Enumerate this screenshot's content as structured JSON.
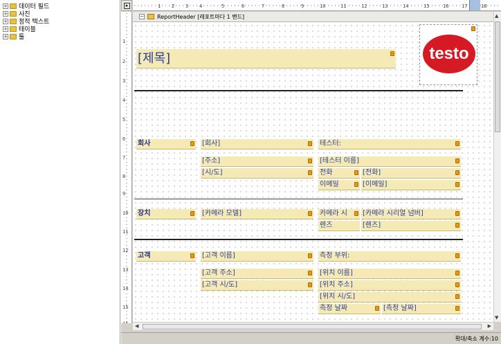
{
  "tree": {
    "items": [
      {
        "label": "데이터 필드",
        "expander": "+"
      },
      {
        "label": "사진",
        "expander": "+"
      },
      {
        "label": "정적 텍스트",
        "expander": "+"
      },
      {
        "label": "테이블",
        "expander": "+"
      },
      {
        "label": "툴",
        "expander": "+"
      }
    ]
  },
  "corner_label": "▸",
  "ruler": {
    "h_ticks": [
      "1",
      "2",
      "3",
      "4",
      "5",
      "6",
      "7",
      "8",
      "9",
      "10",
      "11",
      "12",
      "13",
      "14",
      "15",
      "16",
      "17",
      "18"
    ],
    "v_ticks": [
      "1",
      "2",
      "3",
      "4",
      "5",
      "6",
      "7",
      "8",
      "9",
      "10",
      "11",
      "12",
      "13",
      "14",
      "15",
      "16"
    ]
  },
  "band": {
    "title": "ReportHeader [레포트마다 1 밴드]",
    "collapse": "−"
  },
  "fields": {
    "title": "[제목]",
    "company_label": "회사",
    "company": "[회사]",
    "tester_label": "테스터:",
    "address": "[주소]",
    "tester_name": "[테스터 이름]",
    "city": "[시/도]",
    "phone_label": "전화",
    "phone": "[전화]",
    "email_label": "이메일",
    "email": "[이메일]",
    "device_label": "장치",
    "camera_model": "[카메라 모델]",
    "camera_sn_label": "카메라 시",
    "camera_sn": "[카메라 시리얼 넘버]",
    "lens_label": "렌즈",
    "lens": "[렌즈]",
    "customer_label": "고객",
    "customer_name": "[고객 이름]",
    "measure_label": "측정 부위:",
    "customer_address": "[고객 주소]",
    "location_name": "[위치 이름]",
    "customer_city": "[고객 시/도]",
    "location_address": "[위치 주소]",
    "location_city": "[위치 시/도]",
    "measure_date_label": "측정 날짜",
    "measure_date": "[측정 날짜]"
  },
  "logo": {
    "text": "testo",
    "color": "#d51a25"
  },
  "status": {
    "zoom": "확대/축소 계수:10"
  },
  "colors": {
    "field_bg": "#f5eab5",
    "field_text": "#2a3d9a",
    "lock": "#e69a14"
  }
}
